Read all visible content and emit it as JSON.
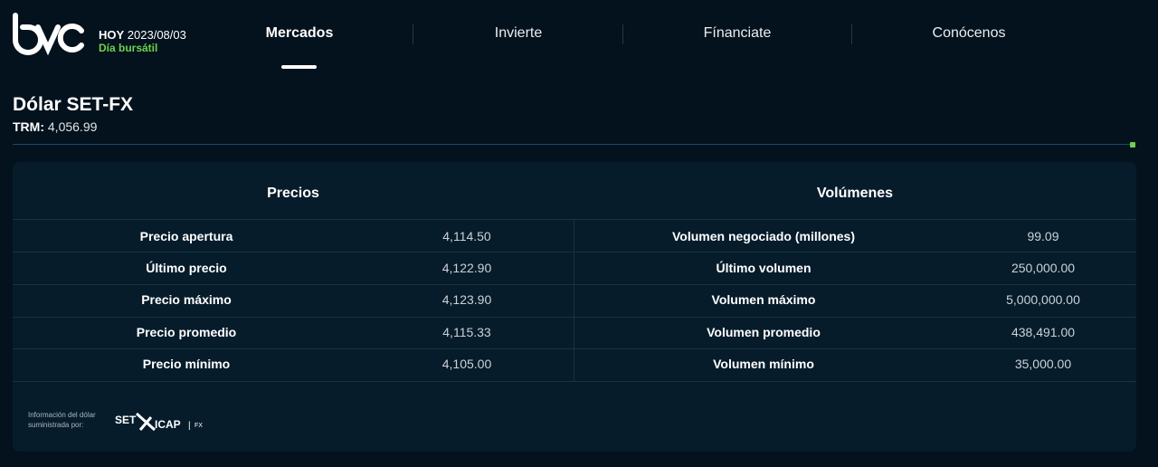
{
  "header": {
    "logo_text": "bvc",
    "date_label": "HOY",
    "date_value": "2023/08/03",
    "market_status": "Día bursátil",
    "nav": [
      {
        "label": "Mercados",
        "active": true
      },
      {
        "label": "Invierte",
        "active": false
      },
      {
        "label": "Fínanciate",
        "active": false
      },
      {
        "label": "Conócenos",
        "active": false
      }
    ]
  },
  "page": {
    "title": "Dólar SET-FX",
    "trm_label": "TRM:",
    "trm_value": "4,056.99"
  },
  "table": {
    "prices_header": "Precios",
    "volumes_header": "Volúmenes",
    "prices": [
      {
        "label": "Precio apertura",
        "value": "4,114.50"
      },
      {
        "label": "Último precio",
        "value": "4,122.90"
      },
      {
        "label": "Precio máximo",
        "value": "4,123.90"
      },
      {
        "label": "Precio promedio",
        "value": "4,115.33"
      },
      {
        "label": "Precio mínimo",
        "value": "4,105.00"
      }
    ],
    "volumes": [
      {
        "label": "Volumen negociado (millones)",
        "value": "99.09"
      },
      {
        "label": "Último volumen",
        "value": "250,000.00"
      },
      {
        "label": "Volumen máximo",
        "value": "5,000,000.00"
      },
      {
        "label": "Volumen promedio",
        "value": "438,491.00"
      },
      {
        "label": "Volumen mínimo",
        "value": "35,000.00"
      }
    ]
  },
  "footer": {
    "source_text": "Información del dólar suministrada por:",
    "provider_logo_text": "SET ICAP | FX"
  },
  "colors": {
    "background": "#03121d",
    "card": "#061c2b",
    "accent_green": "#6fd14a"
  }
}
